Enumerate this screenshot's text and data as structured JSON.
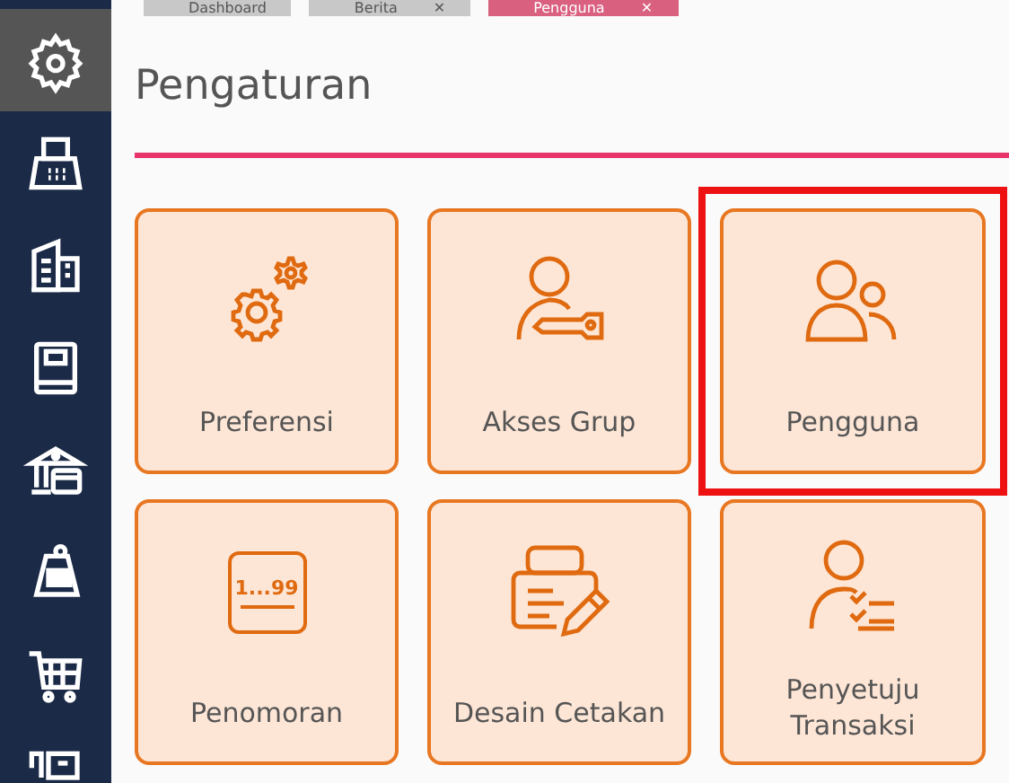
{
  "tabs": [
    {
      "label": "Dashboard",
      "selected": false
    },
    {
      "label": "Berita",
      "close": "✕",
      "selected": false
    },
    {
      "label": "Pengguna",
      "close": "✕",
      "selected": true
    }
  ],
  "sidebar": {
    "items": [
      {
        "kind": "gear",
        "selected": true
      },
      {
        "kind": "fax",
        "selected": false
      },
      {
        "kind": "building",
        "selected": false
      },
      {
        "kind": "book",
        "selected": false
      },
      {
        "kind": "bank",
        "selected": false
      },
      {
        "kind": "tag",
        "selected": false
      },
      {
        "kind": "cart",
        "selected": false
      },
      {
        "kind": "register",
        "selected": false
      }
    ]
  },
  "title": "Pengaturan",
  "cards": [
    {
      "label": "Preferensi",
      "kind": "gears",
      "selected": false
    },
    {
      "label": "Akses Grup",
      "kind": "user-key",
      "selected": false
    },
    {
      "label": "Pengguna",
      "kind": "users",
      "selected": true
    },
    {
      "label": "Penomoran",
      "kind": "numbering",
      "numbering_text": "1...99",
      "selected": false
    },
    {
      "label": "Desain Cetakan",
      "kind": "printer",
      "selected": false
    },
    {
      "label": "Penyetuju Transaksi",
      "kind": "user-check",
      "selected": false
    }
  ]
}
